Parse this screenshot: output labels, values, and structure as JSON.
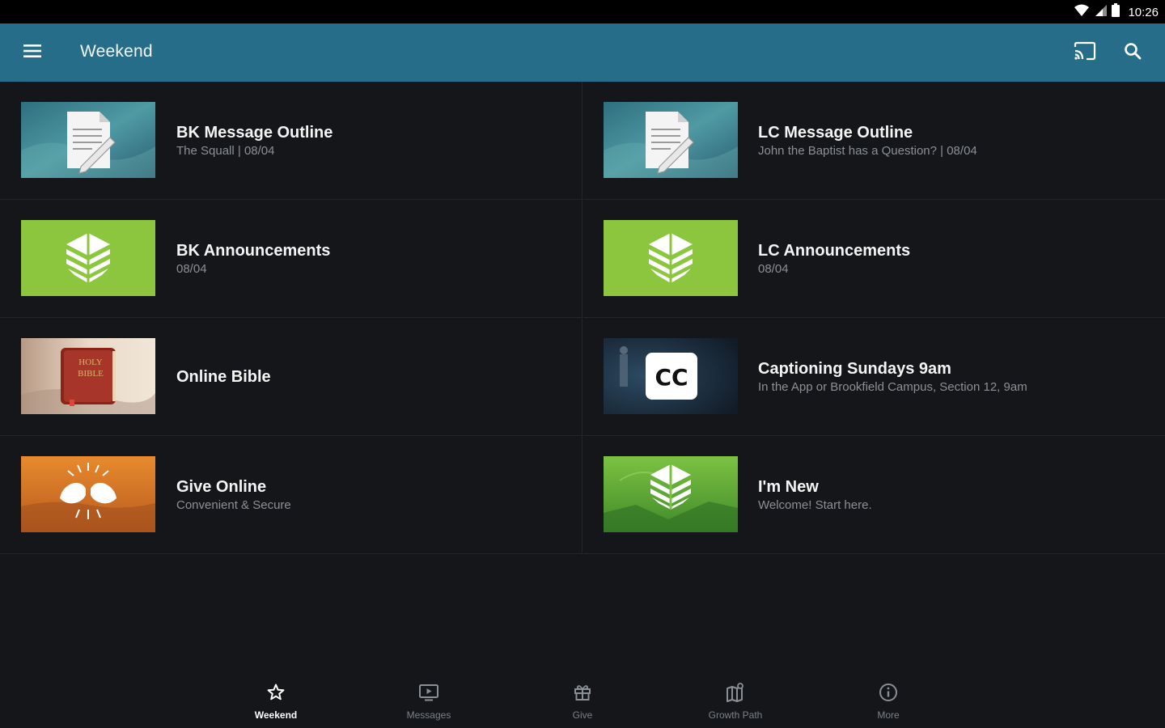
{
  "status_bar": {
    "time": "10:26"
  },
  "app_bar": {
    "title": "Weekend",
    "icons": {
      "menu": "menu-icon",
      "cast": "cast-icon",
      "search": "search-icon"
    },
    "color": "#256d88"
  },
  "cards": [
    {
      "title": "BK Message Outline",
      "subtitle": "The Squall | 08/04",
      "thumbnail": "document-icon"
    },
    {
      "title": "LC Message Outline",
      "subtitle": "John the Baptist has a Question? | 08/04",
      "thumbnail": "document-icon"
    },
    {
      "title": "BK Announcements",
      "subtitle": "08/04",
      "thumbnail": "church-logo-icon"
    },
    {
      "title": "LC Announcements",
      "subtitle": "08/04",
      "thumbnail": "church-logo-icon"
    },
    {
      "title": "Online Bible",
      "subtitle": "",
      "thumbnail": "bible-icon"
    },
    {
      "title": "Captioning Sundays 9am",
      "subtitle": "In the App or Brookfield Campus, Section 12, 9am",
      "thumbnail": "closed-caption-icon",
      "thumb_text": "CC"
    },
    {
      "title": "Give Online",
      "subtitle": "Convenient & Secure",
      "thumbnail": "giving-hands-icon"
    },
    {
      "title": "I'm New",
      "subtitle": "Welcome! Start here.",
      "thumbnail": "church-logo-icon"
    }
  ],
  "bible_cover": {
    "line1": "HOLY",
    "line2": "BIBLE"
  },
  "bottom_nav": [
    {
      "label": "Weekend",
      "icon": "star-icon",
      "active": true
    },
    {
      "label": "Messages",
      "icon": "tv-play-icon",
      "active": false
    },
    {
      "label": "Give",
      "icon": "gift-icon",
      "active": false
    },
    {
      "label": "Growth Path",
      "icon": "map-icon",
      "active": false
    },
    {
      "label": "More",
      "icon": "info-icon",
      "active": false
    }
  ],
  "colors": {
    "background": "#141619",
    "accent_green": "#8cc63f",
    "divider": "#22252a"
  }
}
